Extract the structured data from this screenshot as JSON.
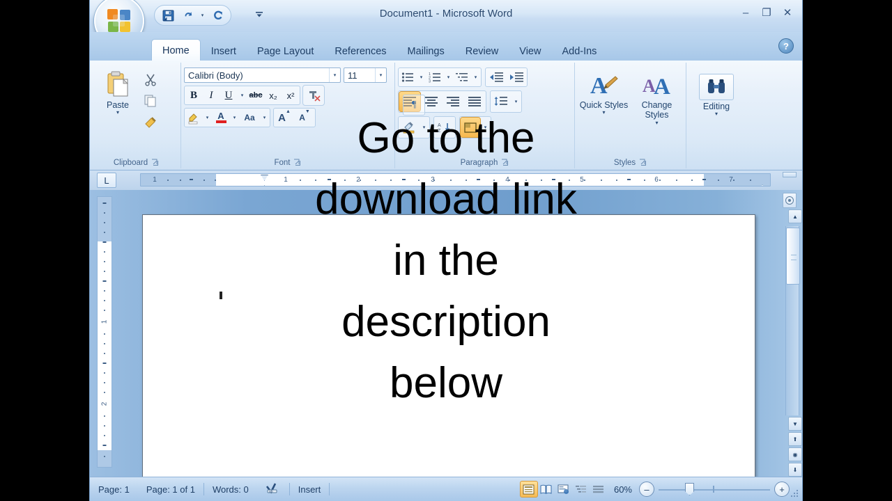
{
  "window": {
    "title": "Document1 - Microsoft Word",
    "minimize": "–",
    "maximize": "❐",
    "close": "✕",
    "help": "?"
  },
  "quick_access": {
    "save": "save-icon",
    "undo": "undo-icon",
    "undo_dropdown": "▾",
    "redo": "redo-icon",
    "customize": "▾"
  },
  "office_button": {
    "label": "office-orb"
  },
  "tabs": [
    {
      "label": "Home",
      "active": true
    },
    {
      "label": "Insert",
      "active": false
    },
    {
      "label": "Page Layout",
      "active": false
    },
    {
      "label": "References",
      "active": false
    },
    {
      "label": "Mailings",
      "active": false
    },
    {
      "label": "Review",
      "active": false
    },
    {
      "label": "View",
      "active": false
    },
    {
      "label": "Add-Ins",
      "active": false
    }
  ],
  "ribbon": {
    "groups": [
      {
        "name": "Clipboard",
        "label": "Clipboard",
        "paste_label": "Paste",
        "paste_caret": "▾",
        "items": [
          "cut-icon",
          "copy-icon",
          "format-painter-icon"
        ]
      },
      {
        "name": "Font",
        "label": "Font",
        "font_name": "Calibri (Body)",
        "font_size": "11",
        "dropdown_arrow": "▾",
        "bold": "B",
        "italic": "I",
        "underline": "U",
        "strikethrough": "abc",
        "subscript": "x₂",
        "superscript": "x²",
        "clear_formatting": "clear-formatting-icon",
        "text_highlight": "highlight-icon",
        "font_color": "A",
        "change_case": "Aa",
        "grow_font": "A",
        "shrink_font": "A"
      },
      {
        "name": "Paragraph",
        "label": "Paragraph",
        "bullets": "bullets-icon",
        "numbering": "numbering-icon",
        "multilevel": "multilevel-list-icon",
        "decrease_indent": "decrease-indent-icon",
        "increase_indent": "increase-indent-icon",
        "align_left": "align-left-icon",
        "align_center": "align-center-icon",
        "align_right": "align-right-icon",
        "justify": "justify-icon",
        "line_spacing": "line-spacing-icon",
        "shading": "shading-icon",
        "sort": "sort-icon",
        "borders": "borders-icon",
        "show_marks": "show-paragraph-marks-icon"
      },
      {
        "name": "Styles",
        "label": "Styles",
        "quick_styles": "Quick Styles",
        "change_styles": "Change Styles",
        "caret": "▾"
      },
      {
        "name": "Editing",
        "label": "",
        "editing_label": "Editing",
        "caret": "▾",
        "icon": "binoculars-icon"
      }
    ]
  },
  "ruler": {
    "tab_selector": "L",
    "h_numbers": [
      "1",
      "1",
      "2",
      "3",
      "4",
      "5",
      "6",
      "7"
    ],
    "v_numbers": [
      "1",
      "2"
    ]
  },
  "status_bar": {
    "page": "Page: 1",
    "page_of": "Page: 1 of 1",
    "words": "Words: 0",
    "proofing": "proofing-icon",
    "insert_mode": "Insert",
    "views": [
      {
        "name": "print-layout-view",
        "active": true
      },
      {
        "name": "full-screen-reading-view",
        "active": false
      },
      {
        "name": "web-layout-view",
        "active": false
      },
      {
        "name": "outline-view",
        "active": false
      },
      {
        "name": "draft-view",
        "active": false
      }
    ],
    "zoom_level": "60%",
    "zoom_out": "–",
    "zoom_in": "+"
  },
  "overlay_caption": {
    "lines": [
      "Go to the",
      "download link",
      "in the",
      "description",
      "below"
    ]
  },
  "colors": {
    "ribbon_bg": "#dbe9f7",
    "title_bg": "#d7e7f7",
    "tab_active": "#ffffff",
    "accent_orange": "#f6b84e",
    "doc_bg": "#7aa6d3",
    "text_blue": "#1f3f66",
    "page_white": "#ffffff",
    "overlay_text": "#000000"
  }
}
